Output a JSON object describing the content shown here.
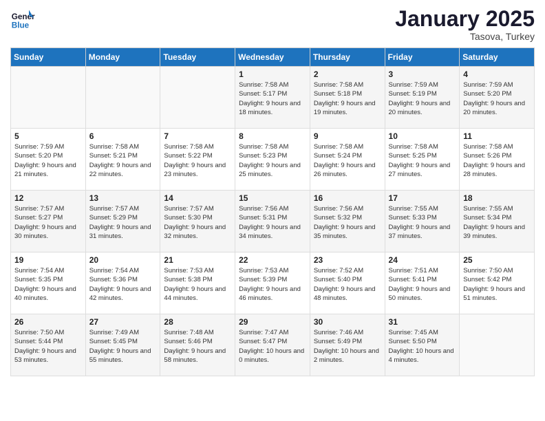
{
  "header": {
    "logo_line1": "General",
    "logo_line2": "Blue",
    "month": "January 2025",
    "location": "Tasova, Turkey"
  },
  "weekdays": [
    "Sunday",
    "Monday",
    "Tuesday",
    "Wednesday",
    "Thursday",
    "Friday",
    "Saturday"
  ],
  "weeks": [
    [
      {
        "day": "",
        "info": ""
      },
      {
        "day": "",
        "info": ""
      },
      {
        "day": "",
        "info": ""
      },
      {
        "day": "1",
        "info": "Sunrise: 7:58 AM\nSunset: 5:17 PM\nDaylight: 9 hours and 18 minutes."
      },
      {
        "day": "2",
        "info": "Sunrise: 7:58 AM\nSunset: 5:18 PM\nDaylight: 9 hours and 19 minutes."
      },
      {
        "day": "3",
        "info": "Sunrise: 7:59 AM\nSunset: 5:19 PM\nDaylight: 9 hours and 20 minutes."
      },
      {
        "day": "4",
        "info": "Sunrise: 7:59 AM\nSunset: 5:20 PM\nDaylight: 9 hours and 20 minutes."
      }
    ],
    [
      {
        "day": "5",
        "info": "Sunrise: 7:59 AM\nSunset: 5:20 PM\nDaylight: 9 hours and 21 minutes."
      },
      {
        "day": "6",
        "info": "Sunrise: 7:58 AM\nSunset: 5:21 PM\nDaylight: 9 hours and 22 minutes."
      },
      {
        "day": "7",
        "info": "Sunrise: 7:58 AM\nSunset: 5:22 PM\nDaylight: 9 hours and 23 minutes."
      },
      {
        "day": "8",
        "info": "Sunrise: 7:58 AM\nSunset: 5:23 PM\nDaylight: 9 hours and 25 minutes."
      },
      {
        "day": "9",
        "info": "Sunrise: 7:58 AM\nSunset: 5:24 PM\nDaylight: 9 hours and 26 minutes."
      },
      {
        "day": "10",
        "info": "Sunrise: 7:58 AM\nSunset: 5:25 PM\nDaylight: 9 hours and 27 minutes."
      },
      {
        "day": "11",
        "info": "Sunrise: 7:58 AM\nSunset: 5:26 PM\nDaylight: 9 hours and 28 minutes."
      }
    ],
    [
      {
        "day": "12",
        "info": "Sunrise: 7:57 AM\nSunset: 5:27 PM\nDaylight: 9 hours and 30 minutes."
      },
      {
        "day": "13",
        "info": "Sunrise: 7:57 AM\nSunset: 5:29 PM\nDaylight: 9 hours and 31 minutes."
      },
      {
        "day": "14",
        "info": "Sunrise: 7:57 AM\nSunset: 5:30 PM\nDaylight: 9 hours and 32 minutes."
      },
      {
        "day": "15",
        "info": "Sunrise: 7:56 AM\nSunset: 5:31 PM\nDaylight: 9 hours and 34 minutes."
      },
      {
        "day": "16",
        "info": "Sunrise: 7:56 AM\nSunset: 5:32 PM\nDaylight: 9 hours and 35 minutes."
      },
      {
        "day": "17",
        "info": "Sunrise: 7:55 AM\nSunset: 5:33 PM\nDaylight: 9 hours and 37 minutes."
      },
      {
        "day": "18",
        "info": "Sunrise: 7:55 AM\nSunset: 5:34 PM\nDaylight: 9 hours and 39 minutes."
      }
    ],
    [
      {
        "day": "19",
        "info": "Sunrise: 7:54 AM\nSunset: 5:35 PM\nDaylight: 9 hours and 40 minutes."
      },
      {
        "day": "20",
        "info": "Sunrise: 7:54 AM\nSunset: 5:36 PM\nDaylight: 9 hours and 42 minutes."
      },
      {
        "day": "21",
        "info": "Sunrise: 7:53 AM\nSunset: 5:38 PM\nDaylight: 9 hours and 44 minutes."
      },
      {
        "day": "22",
        "info": "Sunrise: 7:53 AM\nSunset: 5:39 PM\nDaylight: 9 hours and 46 minutes."
      },
      {
        "day": "23",
        "info": "Sunrise: 7:52 AM\nSunset: 5:40 PM\nDaylight: 9 hours and 48 minutes."
      },
      {
        "day": "24",
        "info": "Sunrise: 7:51 AM\nSunset: 5:41 PM\nDaylight: 9 hours and 50 minutes."
      },
      {
        "day": "25",
        "info": "Sunrise: 7:50 AM\nSunset: 5:42 PM\nDaylight: 9 hours and 51 minutes."
      }
    ],
    [
      {
        "day": "26",
        "info": "Sunrise: 7:50 AM\nSunset: 5:44 PM\nDaylight: 9 hours and 53 minutes."
      },
      {
        "day": "27",
        "info": "Sunrise: 7:49 AM\nSunset: 5:45 PM\nDaylight: 9 hours and 55 minutes."
      },
      {
        "day": "28",
        "info": "Sunrise: 7:48 AM\nSunset: 5:46 PM\nDaylight: 9 hours and 58 minutes."
      },
      {
        "day": "29",
        "info": "Sunrise: 7:47 AM\nSunset: 5:47 PM\nDaylight: 10 hours and 0 minutes."
      },
      {
        "day": "30",
        "info": "Sunrise: 7:46 AM\nSunset: 5:49 PM\nDaylight: 10 hours and 2 minutes."
      },
      {
        "day": "31",
        "info": "Sunrise: 7:45 AM\nSunset: 5:50 PM\nDaylight: 10 hours and 4 minutes."
      },
      {
        "day": "",
        "info": ""
      }
    ]
  ]
}
